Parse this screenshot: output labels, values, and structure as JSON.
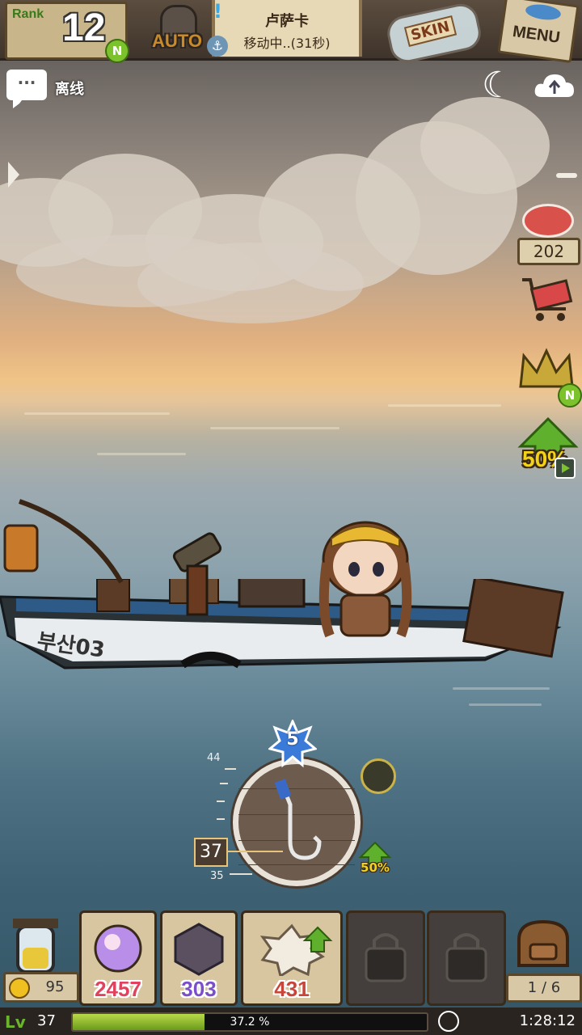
{
  "top": {
    "rank_label": "Rank",
    "rank_value": "12",
    "rank_badge": "N",
    "auto_label": "AUTO",
    "location_name": "卢萨卡",
    "location_status": "移动中..(31秒)",
    "alert_mark": "!",
    "skin_label": "SKIN",
    "menu_label": "MENU"
  },
  "status": {
    "chat_text": "离线",
    "chat_dots": "···",
    "night_icon": "moon-icon",
    "cloud_icon": "cloud-upload-icon"
  },
  "side": {
    "meat_count": "202",
    "crown_badge": "N",
    "boost_label": "50%"
  },
  "boat": {
    "name": "부산03"
  },
  "fishing": {
    "level_badge": "5",
    "depth_current": "37",
    "depth_top": "44",
    "depth_bottom": "35",
    "bait_boost": "50%"
  },
  "inventory": {
    "gold": "95",
    "slots": [
      {
        "value": "2457",
        "color": "#e0435e"
      },
      {
        "value": "303",
        "color": "#7b4fc9"
      },
      {
        "value": "431",
        "color": "#c8453a"
      }
    ],
    "bag_count": "1 / 6"
  },
  "footer": {
    "level_icon": "Lv",
    "level": "37",
    "xp_percent": "37.2 %",
    "xp_fraction": 0.372,
    "time": "1:28:12"
  }
}
